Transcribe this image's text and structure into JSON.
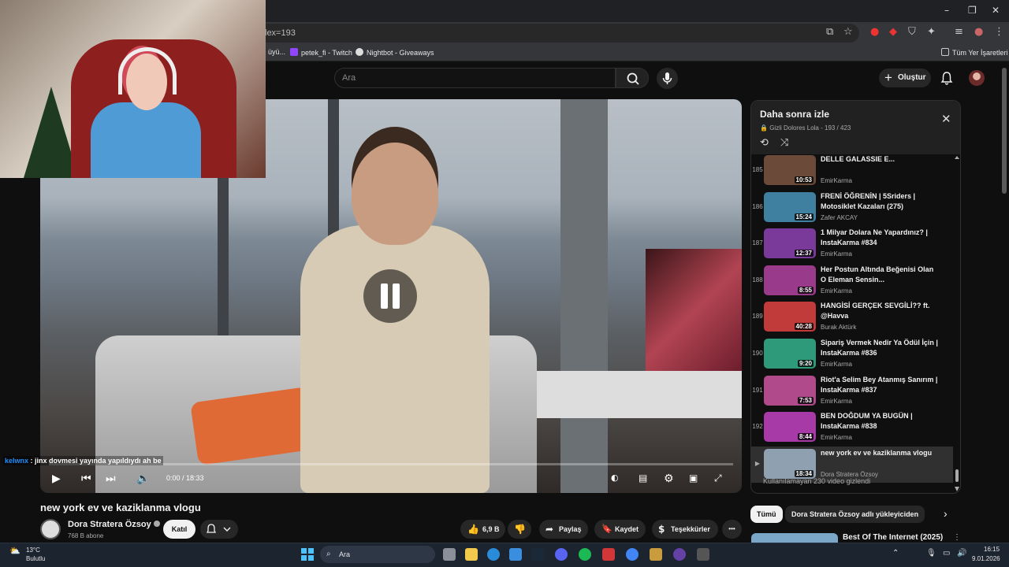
{
  "browser": {
    "url_fragment": "lex=193",
    "bookmarks": [
      {
        "label": "üyü..."
      },
      {
        "label": "petek_fi - Twitch"
      },
      {
        "label": "Nightbot - Giveaways"
      }
    ],
    "all_bookmarks": "Tüm Yer İşaretleri",
    "window_controls": {
      "minimize": "–",
      "restore": "❐",
      "close": "✕"
    }
  },
  "header": {
    "search_placeholder": "Ara",
    "create_label": "Oluştur"
  },
  "player": {
    "time": "0:00 / 18:33",
    "progress_fraction": 0.0,
    "chat_user": "kelwnx",
    "chat_message": " : jinx dovmesi yayında yapıldıydı ah be"
  },
  "video": {
    "title": "new york ev ve kaziklanma vlogu",
    "channel": "Dora Stratera Özsoy",
    "subscribers": "768 B abone",
    "join_label": "Katıl",
    "like_count": "6,9 B",
    "share_label": "Paylaş",
    "save_label": "Kaydet",
    "thanks_label": "Teşekkürler",
    "more_label": "•••"
  },
  "playlist": {
    "title": "Daha sonra izle",
    "meta": "Gizli Dolores Lola - 193 / 423",
    "hidden_note": "Kullanılamayan 230 video gizlendi",
    "items": [
      {
        "index": "185",
        "title": "DELLE GALASSIE E...",
        "channel": "EmirKarma",
        "duration": "10:53",
        "color": "#6b4a3a"
      },
      {
        "index": "186",
        "title": "FRENİ ÖĞRENİN | 5Sriders | Motosiklet Kazaları (275)",
        "channel": "Zafer AKCAY",
        "duration": "15:24",
        "color": "#3f7fa0"
      },
      {
        "index": "187",
        "title": "1 Milyar Dolara Ne Yapardınız? | InstaKarma #834",
        "channel": "EmirKarma",
        "duration": "12:37",
        "color": "#7a3a9a"
      },
      {
        "index": "188",
        "title": "Her Postun Altında Beğenisi Olan O Eleman Sensin...",
        "channel": "EmirKarma",
        "duration": "8:55",
        "color": "#9a3a8a"
      },
      {
        "index": "189",
        "title": "HANGİSİ GERÇEK SEVGİLİ?? ft. @Havva",
        "channel": "Burak Aktürk",
        "duration": "40:28",
        "color": "#c23b3b"
      },
      {
        "index": "190",
        "title": "Sipariş Vermek Nedir Ya Ödül İçin | InstaKarma #836",
        "channel": "EmirKarma",
        "duration": "9:20",
        "color": "#2f9a7a"
      },
      {
        "index": "191",
        "title": "Riot'a Selim Bey Atanmış Sanırım | InstaKarma #837",
        "channel": "EmirKarma",
        "duration": "7:53",
        "color": "#b04a8a"
      },
      {
        "index": "192",
        "title": "BEN DOĞDUM YA BUGÜN | InstaKarma #838",
        "channel": "EmirKarma",
        "duration": "8:44",
        "color": "#a83aa8"
      },
      {
        "index": "▶",
        "title": "new york ev ve kaziklanma vlogu",
        "channel": "Dora Stratera Özsoy",
        "duration": "18:34",
        "color": "#8fa0b0"
      }
    ]
  },
  "chips": {
    "all": "Tümü",
    "from_uploader": "Dora Stratera Özsoy adlı yükleyiciden"
  },
  "next_video": {
    "title": "Best Of The Internet (2025)"
  },
  "taskbar": {
    "temperature": "13°C",
    "weather": "Bulutlu",
    "search": "Ara",
    "time": "16:15",
    "date": "9.01.2026"
  }
}
